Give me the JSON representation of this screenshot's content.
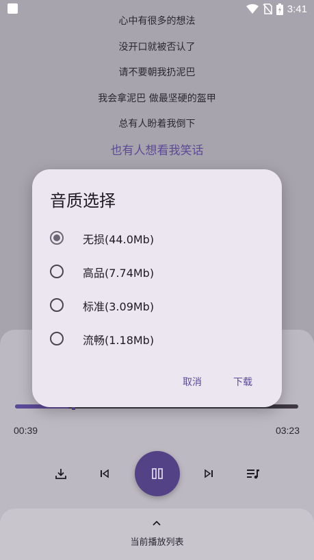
{
  "status_bar": {
    "time": "3:41"
  },
  "lyrics": [
    "心中有很多的想法",
    "没开口就被否认了",
    "请不要朝我扔泥巴",
    "我会拿泥巴 做最坚硬的盔甲",
    "总有人盼着我倒下",
    "也有人想看我笑话"
  ],
  "player": {
    "current_time": "00:39",
    "total_time": "03:23",
    "progress": 0.19,
    "queue_label": "当前播放列表"
  },
  "dialog": {
    "title": "音质选择",
    "options": [
      {
        "label": "无损(44.0Mb)",
        "selected": true
      },
      {
        "label": "高品(7.74Mb)",
        "selected": false
      },
      {
        "label": "标准(3.09Mb)",
        "selected": false
      },
      {
        "label": "流畅(1.18Mb)",
        "selected": false
      }
    ],
    "cancel_label": "取消",
    "download_label": "下载"
  },
  "colors": {
    "accent": "#5b4a97",
    "scrim": "#a8a4ad",
    "dialog_bg": "#ece6f0"
  }
}
